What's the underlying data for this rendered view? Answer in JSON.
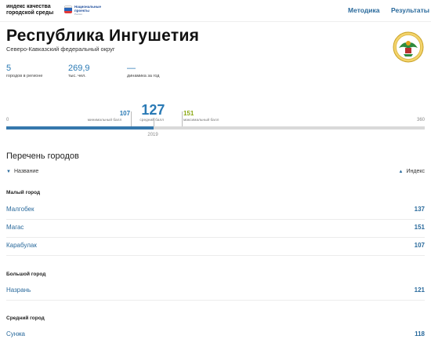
{
  "header": {
    "logo_line1": "индекс качества",
    "logo_line2": "городской среды",
    "np_line1": "Национальные",
    "np_line2": "проекты",
    "np_line3": "России",
    "nav": [
      "Методика",
      "Результаты"
    ]
  },
  "region": {
    "title": "Республика Ингушетия",
    "district": "Северо-Кавказский федеральный округ"
  },
  "stats": [
    {
      "value": "5",
      "label": "городов в регионе"
    },
    {
      "value": "269,9",
      "label": "тыс. чел."
    },
    {
      "value": "—",
      "label": "динамика за год"
    }
  ],
  "scale": {
    "min": 0,
    "max": 360,
    "min_label": "0",
    "max_label": "360",
    "min_score": 107,
    "min_score_label": "минимальный балл",
    "avg_score": 127,
    "avg_score_label": "средний балл",
    "max_score": 151,
    "max_score_label": "максимальный балл",
    "year": "2019"
  },
  "cities_section": {
    "title": "Перечень городов",
    "col_name": "Название",
    "col_index": "Индекс",
    "groups": [
      {
        "label": "Малый город",
        "cities": [
          {
            "name": "Малгобек",
            "index": "137"
          },
          {
            "name": "Магас",
            "index": "151"
          },
          {
            "name": "Карабулак",
            "index": "107"
          }
        ]
      },
      {
        "label": "Большой город",
        "cities": [
          {
            "name": "Назрань",
            "index": "121"
          }
        ]
      },
      {
        "label": "Средний город",
        "cities": [
          {
            "name": "Сунжа",
            "index": "118"
          }
        ]
      }
    ]
  },
  "colors": {
    "accent": "#2a7ab5",
    "link": "#2a6a9c",
    "max_marker": "#8aa812",
    "track": "#d9d9d9"
  },
  "icons": {
    "emblem": "coat-of-arms-ingushetia",
    "sort_desc": "triangle-down-icon",
    "sort_asc": "triangle-up-icon"
  }
}
